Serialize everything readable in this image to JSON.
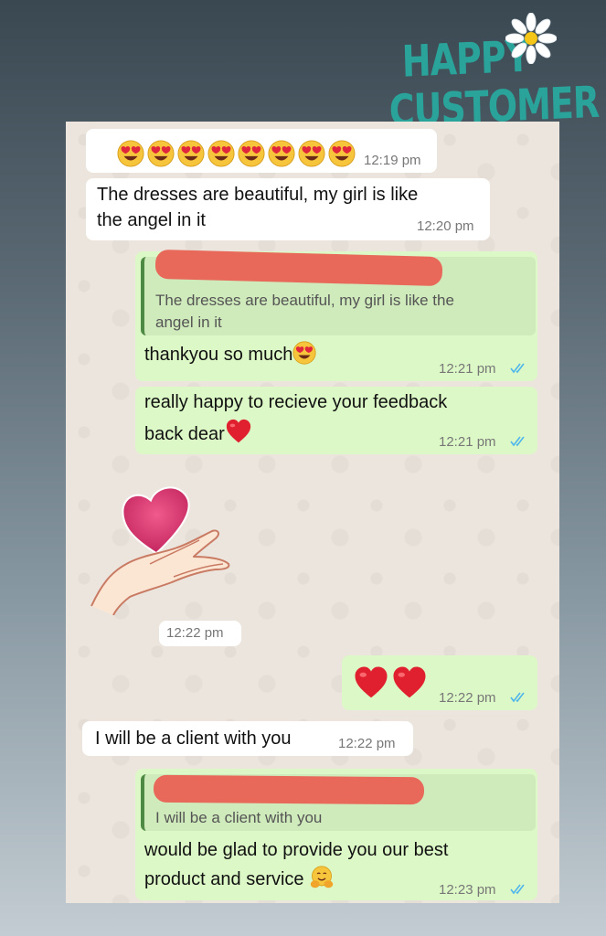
{
  "banner": {
    "line1": "HAPPY",
    "line2": "CUSTOMER"
  },
  "colors": {
    "incoming": "#ffffff",
    "outgoing": "#dcf8c6",
    "tick": "#4fb6ec",
    "redaction": "#e8685a",
    "banner": "#2aa39a"
  },
  "messages": [
    {
      "id": "m1",
      "dir": "in",
      "text": "",
      "emoji": [
        "heart-eyes-emoji",
        "heart-eyes-emoji",
        "heart-eyes-emoji",
        "heart-eyes-emoji",
        "heart-eyes-emoji",
        "heart-eyes-emoji",
        "heart-eyes-emoji",
        "heart-eyes-emoji"
      ],
      "time": "12:19 pm"
    },
    {
      "id": "m2",
      "dir": "in",
      "line1": "The dresses are beautiful, my girl is like",
      "line2": "the angel in it",
      "time": "12:20 pm"
    },
    {
      "id": "m3",
      "dir": "out",
      "quote_line1": "The dresses are beautiful, my girl is like the",
      "quote_line2": "angel in it",
      "text": "thankyou so much",
      "emoji": "heart-eyes-emoji",
      "time": "12:21 pm"
    },
    {
      "id": "m4",
      "dir": "out",
      "line1": "really happy to recieve your feedback",
      "line2": "back dear",
      "emoji": "red-heart-emoji",
      "time": "12:21 pm"
    },
    {
      "id": "m5",
      "dir": "in",
      "sticker": "hands-holding-heart-sticker",
      "time": "12:22 pm"
    },
    {
      "id": "m6",
      "dir": "out",
      "emoji": [
        "red-heart-emoji",
        "red-heart-emoji"
      ],
      "time": "12:22 pm"
    },
    {
      "id": "m7",
      "dir": "in",
      "text": "I will be a client with you",
      "time": "12:22 pm"
    },
    {
      "id": "m8",
      "dir": "out",
      "quote_line1": "I will be a client with you",
      "line1": "would be glad to provide you our best",
      "line2": "product  and service",
      "emoji": "hugging-face-emoji",
      "time": "12:23 pm"
    }
  ]
}
